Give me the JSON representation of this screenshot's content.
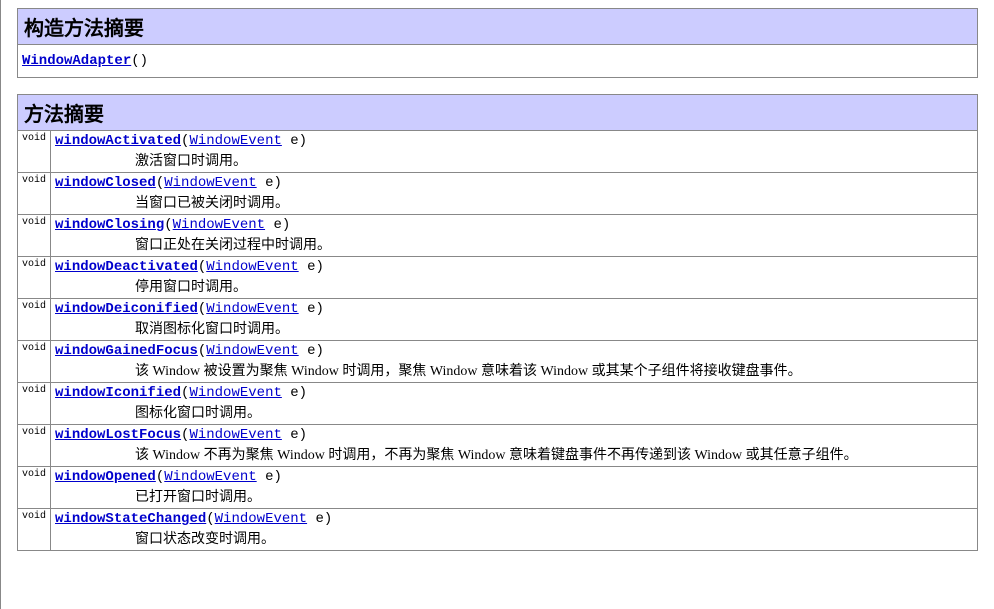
{
  "constructor_summary": {
    "title": "构造方法摘要",
    "rows": [
      {
        "name": "WindowAdapter",
        "parens": "()"
      }
    ]
  },
  "method_summary": {
    "title": "方法摘要",
    "rows": [
      {
        "ret": "void",
        "name": "windowActivated",
        "param_open": "(",
        "param_type": "WindowEvent",
        "param_rest": " e)",
        "desc": "激活窗口时调用。"
      },
      {
        "ret": "void",
        "name": "windowClosed",
        "param_open": "(",
        "param_type": "WindowEvent",
        "param_rest": " e)",
        "desc": "当窗口已被关闭时调用。"
      },
      {
        "ret": "void",
        "name": "windowClosing",
        "param_open": "(",
        "param_type": "WindowEvent",
        "param_rest": " e)",
        "desc": "窗口正处在关闭过程中时调用。"
      },
      {
        "ret": "void",
        "name": "windowDeactivated",
        "param_open": "(",
        "param_type": "WindowEvent",
        "param_rest": " e)",
        "desc": "停用窗口时调用。"
      },
      {
        "ret": "void",
        "name": "windowDeiconified",
        "param_open": "(",
        "param_type": "WindowEvent",
        "param_rest": " e)",
        "desc": "取消图标化窗口时调用。"
      },
      {
        "ret": "void",
        "name": "windowGainedFocus",
        "param_open": "(",
        "param_type": "WindowEvent",
        "param_rest": " e)",
        "desc": "该 Window 被设置为聚焦 Window 时调用，聚焦 Window 意味着该 Window 或其某个子组件将接收键盘事件。"
      },
      {
        "ret": "void",
        "name": "windowIconified",
        "param_open": "(",
        "param_type": "WindowEvent",
        "param_rest": " e)",
        "desc": "图标化窗口时调用。"
      },
      {
        "ret": "void",
        "name": "windowLostFocus",
        "param_open": "(",
        "param_type": "WindowEvent",
        "param_rest": " e)",
        "desc": "该 Window 不再为聚焦 Window 时调用，不再为聚焦 Window 意味着键盘事件不再传递到该 Window 或其任意子组件。"
      },
      {
        "ret": "void",
        "name": "windowOpened",
        "param_open": "(",
        "param_type": "WindowEvent",
        "param_rest": " e)",
        "desc": "已打开窗口时调用。"
      },
      {
        "ret": "void",
        "name": "windowStateChanged",
        "param_open": "(",
        "param_type": "WindowEvent",
        "param_rest": " e)",
        "desc": "窗口状态改变时调用。"
      }
    ]
  }
}
